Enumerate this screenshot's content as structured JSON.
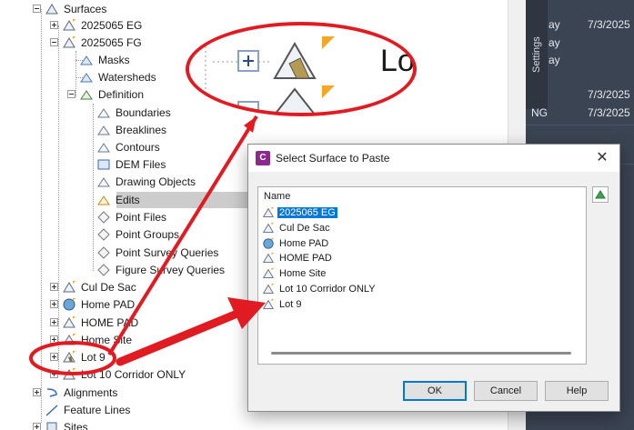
{
  "tree": {
    "surfaces_label": "Surfaces",
    "items": [
      {
        "label": "2025065 EG"
      },
      {
        "label": "2025065 FG"
      },
      {
        "label": "Masks"
      },
      {
        "label": "Watersheds"
      },
      {
        "label": "Definition"
      },
      {
        "label": "Boundaries"
      },
      {
        "label": "Breaklines"
      },
      {
        "label": "Contours"
      },
      {
        "label": "DEM Files"
      },
      {
        "label": "Drawing Objects"
      },
      {
        "label": "Edits"
      },
      {
        "label": "Point Files"
      },
      {
        "label": "Point Groups"
      },
      {
        "label": "Point Survey Queries"
      },
      {
        "label": "Figure Survey Queries"
      },
      {
        "label": "Cul De Sac"
      },
      {
        "label": "Home PAD"
      },
      {
        "label": "HOME PAD"
      },
      {
        "label": "Home Site"
      },
      {
        "label": "Lot 9"
      },
      {
        "label": "Lot 10 Corridor ONLY"
      },
      {
        "label": "Alignments"
      },
      {
        "label": "Feature Lines"
      },
      {
        "label": "Sites"
      }
    ]
  },
  "callout": {
    "text": "Lo"
  },
  "right_panel": {
    "settings_tab": "Settings",
    "rows": [
      {
        "col1": "ay",
        "col2": "7/3/2025"
      },
      {
        "col1": "ay",
        "col2": ""
      },
      {
        "col1": "ay",
        "col2": ""
      },
      {
        "col1": "",
        "col2": "7/3/2025"
      },
      {
        "col1": "NG",
        "col2": "7/3/2025"
      }
    ]
  },
  "dialog": {
    "title": "Select Surface to Paste",
    "app_icon_label": "C",
    "column_header": "Name",
    "surfaces": [
      {
        "label": "2025065 EG",
        "selected": true
      },
      {
        "label": "Cul De Sac",
        "selected": false
      },
      {
        "label": "Home PAD",
        "selected": false
      },
      {
        "label": "HOME PAD",
        "selected": false
      },
      {
        "label": "Home Site",
        "selected": false
      },
      {
        "label": "Lot 10 Corridor ONLY",
        "selected": false
      },
      {
        "label": "Lot 9",
        "selected": false
      }
    ],
    "ok_label": "OK",
    "cancel_label": "Cancel",
    "help_label": "Help",
    "close_glyph": "✕"
  },
  "colors": {
    "annotation": "#e11b22",
    "selection": "#0078d7",
    "dark_panel": "#3b4453"
  },
  "icons": {
    "surface": "surface-icon",
    "definition": "definition-icon",
    "close": "close-icon"
  }
}
